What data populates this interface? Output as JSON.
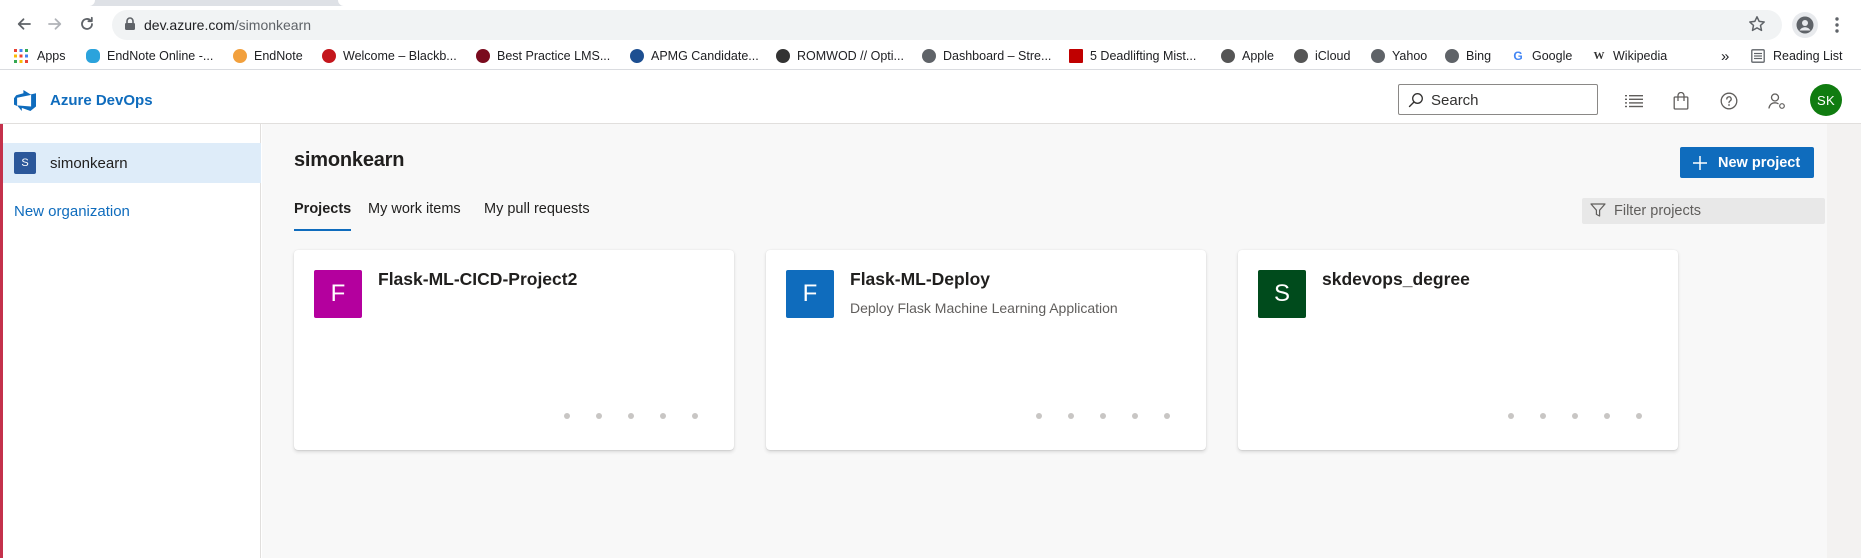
{
  "browser": {
    "url_host": "dev.azure.com",
    "url_path": "/simonkearn",
    "bookmarks": [
      {
        "label": "Apps",
        "icon": "apps-grid-icon",
        "color": "#4285f4"
      },
      {
        "label": "EndNote Online -...",
        "icon": "endnote-online-icon",
        "color": "#2ba3dc"
      },
      {
        "label": "EndNote",
        "icon": "endnote-icon",
        "color": "#f2a03d"
      },
      {
        "label": "Welcome – Blackb...",
        "icon": "blackboard-icon",
        "color": "#c4161c"
      },
      {
        "label": "Best Practice LMS...",
        "icon": "best-practice-icon",
        "color": "#7a0b1e"
      },
      {
        "label": "APMG Candidate...",
        "icon": "apmg-icon",
        "color": "#1d4f91"
      },
      {
        "label": "ROMWOD // Opti...",
        "icon": "romwod-icon",
        "color": "#333333"
      },
      {
        "label": "Dashboard – Stre...",
        "icon": "globe-icon",
        "color": "#5f6368"
      },
      {
        "label": "5 Deadlifting Mist...",
        "icon": "deadlifting-icon",
        "color": "#c00000"
      },
      {
        "label": "Apple",
        "icon": "apple-icon",
        "color": "#555555"
      },
      {
        "label": "iCloud",
        "icon": "icloud-icon",
        "color": "#555555"
      },
      {
        "label": "Yahoo",
        "icon": "globe-icon",
        "color": "#5f6368"
      },
      {
        "label": "Bing",
        "icon": "globe-icon",
        "color": "#5f6368"
      },
      {
        "label": "Google",
        "icon": "google-icon",
        "color": "#4285f4"
      },
      {
        "label": "Wikipedia",
        "icon": "wikipedia-icon",
        "color": "#333333"
      }
    ],
    "overflow_label": "»",
    "reading_list": "Reading List"
  },
  "app": {
    "title": "Azure DevOps",
    "search_placeholder": "Search",
    "avatar_initials": "SK",
    "accent_color": "#0f6cbd"
  },
  "sidebar": {
    "org_initial": "S",
    "org_name": "simonkearn",
    "new_org": "New organization"
  },
  "main": {
    "title": "simonkearn",
    "new_project_label": "New project",
    "tabs": [
      {
        "label": "Projects",
        "active": true
      },
      {
        "label": "My work items",
        "active": false
      },
      {
        "label": "My pull requests",
        "active": false
      }
    ],
    "filter_placeholder": "Filter projects",
    "projects": [
      {
        "initial": "F",
        "name": "Flask-ML-CICD-Project2",
        "description": "",
        "color": "#b4009e"
      },
      {
        "initial": "F",
        "name": "Flask-ML-Deploy",
        "description": "Deploy Flask Machine Learning Application",
        "color": "#0f6cbd"
      },
      {
        "initial": "S",
        "name": "skdevops_degree",
        "description": "",
        "color": "#004b1c"
      }
    ]
  }
}
